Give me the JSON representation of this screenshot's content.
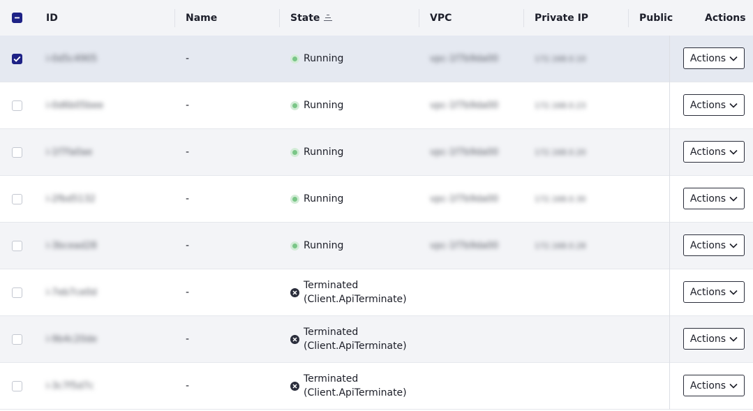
{
  "header": {
    "id": "ID",
    "name": "Name",
    "state": "State",
    "vpc": "VPC",
    "private_ip": "Private IP",
    "public": "Public",
    "actions": "Actions"
  },
  "icons": {
    "sort": "sort-ascending-icon",
    "running": "status-running-icon",
    "terminated": "status-terminated-icon",
    "chevron": "chevron-down-icon",
    "check": "check-icon",
    "minus": "minus-icon"
  },
  "colors": {
    "accent": "#1e2286",
    "running_dot": "#7ac687",
    "terminated_icon": "#2b2e3c"
  },
  "rows": [
    {
      "id": "i-0d5c4905",
      "name": "-",
      "state_line1": "Running",
      "state_line2": "",
      "status": "running",
      "vpc": "vpc-1f7b9da00",
      "private_ip": "172.168.0.10",
      "actions_label": "Actions",
      "checked": true
    },
    {
      "id": "i-0d6b05bee",
      "name": "-",
      "state_line1": "Running",
      "state_line2": "",
      "status": "running",
      "vpc": "vpc-1f7b9da00",
      "private_ip": "172.168.0.23",
      "actions_label": "Actions",
      "checked": false
    },
    {
      "id": "i-1f7fa0ae",
      "name": "-",
      "state_line1": "Running",
      "state_line2": "",
      "status": "running",
      "vpc": "vpc-1f7b9da00",
      "private_ip": "172.168.0.20",
      "actions_label": "Actions",
      "checked": false
    },
    {
      "id": "i-2fbd5132",
      "name": "-",
      "state_line1": "Running",
      "state_line2": "",
      "status": "running",
      "vpc": "vpc-1f7b9da00",
      "private_ip": "172.168.0.30",
      "actions_label": "Actions",
      "checked": false
    },
    {
      "id": "i-3bcead28",
      "name": "-",
      "state_line1": "Running",
      "state_line2": "",
      "status": "running",
      "vpc": "vpc-1f7b9da00",
      "private_ip": "172.168.0.28",
      "actions_label": "Actions",
      "checked": false
    },
    {
      "id": "i-7eb7ce0d",
      "name": "-",
      "state_line1": "Terminated",
      "state_line2": "(Client.ApiTerminate)",
      "status": "terminated",
      "vpc": "",
      "private_ip": "",
      "actions_label": "Actions",
      "checked": false
    },
    {
      "id": "i-9b4c20de",
      "name": "-",
      "state_line1": "Terminated",
      "state_line2": "(Client.ApiTerminate)",
      "status": "terminated",
      "vpc": "",
      "private_ip": "",
      "actions_label": "Actions",
      "checked": false
    },
    {
      "id": "i-3c7f5d7c",
      "name": "-",
      "state_line1": "Terminated",
      "state_line2": "(Client.ApiTerminate)",
      "status": "terminated",
      "vpc": "",
      "private_ip": "",
      "actions_label": "Actions",
      "checked": false
    }
  ]
}
